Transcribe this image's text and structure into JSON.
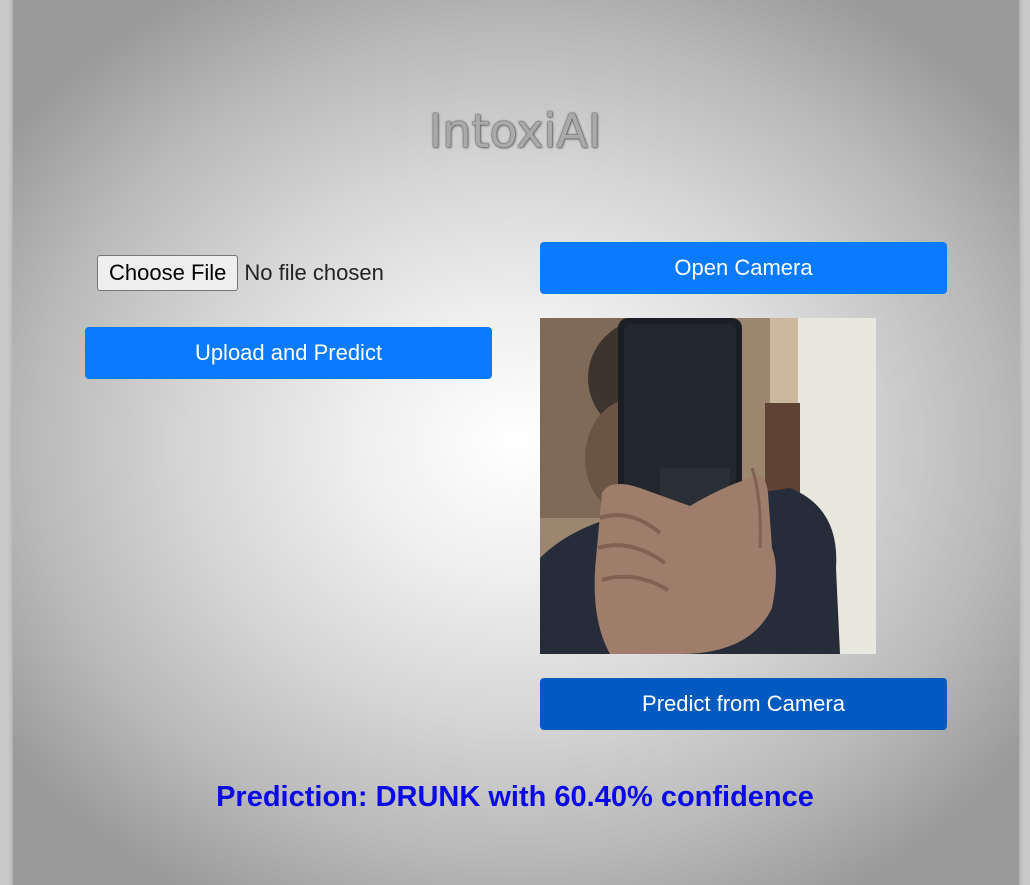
{
  "app": {
    "title": "IntoxiAI"
  },
  "upload": {
    "choose_label": "Choose File",
    "file_status": "No file chosen",
    "upload_label": "Upload and Predict"
  },
  "camera": {
    "open_label": "Open Camera",
    "predict_label": "Predict from Camera",
    "feed_icon": "webcam-feed"
  },
  "result": {
    "text": "Prediction: DRUNK with 60.40% confidence"
  },
  "colors": {
    "primary": "#0a7bff",
    "primary_dark": "#005ac0",
    "prediction_text": "#0a0ae8"
  }
}
